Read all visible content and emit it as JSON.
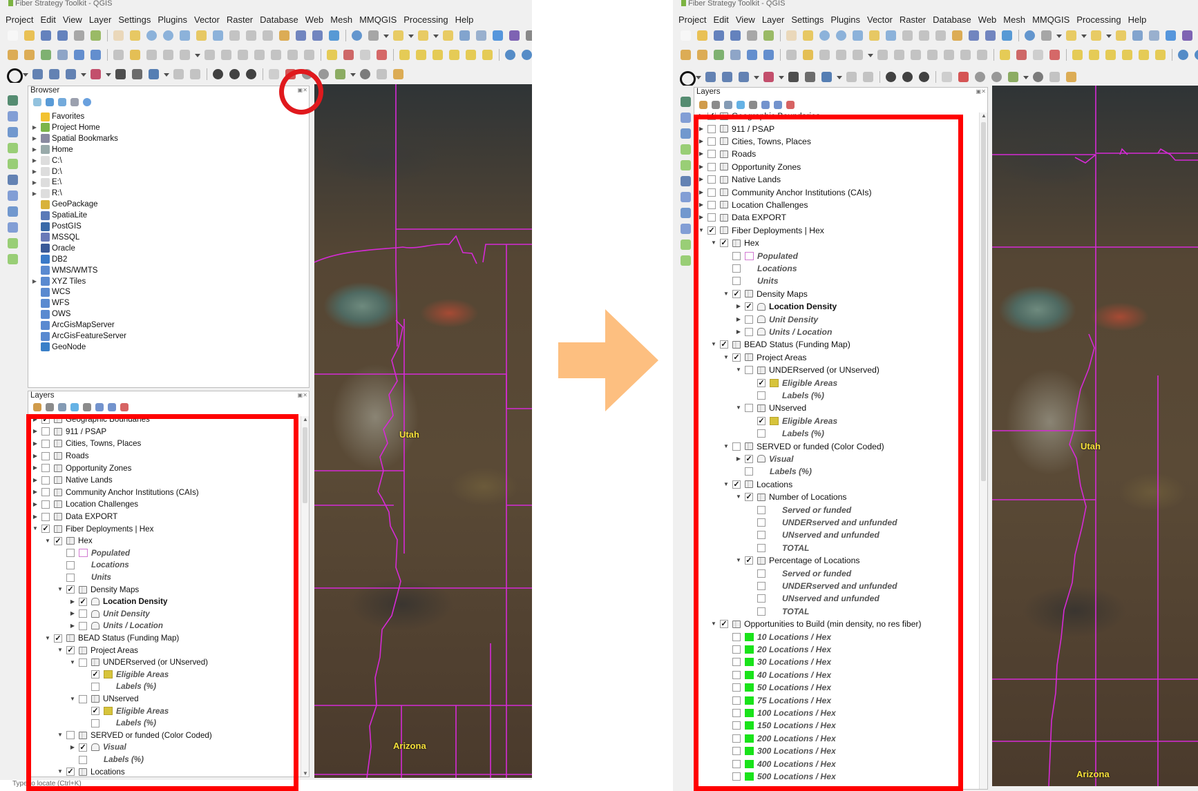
{
  "title_bar": {
    "text": "Fiber Strategy Toolkit - QGIS"
  },
  "menu": [
    "Project",
    "Edit",
    "View",
    "Layer",
    "Settings",
    "Plugins",
    "Vector",
    "Raster",
    "Database",
    "Web",
    "Mesh",
    "MMQGIS",
    "Processing",
    "Help"
  ],
  "browser": {
    "title": "Browser",
    "items": [
      {
        "label": "Favorites",
        "icon": "star-icon",
        "expandable": false
      },
      {
        "label": "Project Home",
        "icon": "project-home-icon",
        "expandable": true
      },
      {
        "label": "Spatial Bookmarks",
        "icon": "bookmarks-icon",
        "expandable": true
      },
      {
        "label": "Home",
        "icon": "home-folder-icon",
        "expandable": true
      },
      {
        "label": "C:\\",
        "icon": "drive-icon",
        "expandable": true
      },
      {
        "label": "D:\\",
        "icon": "drive-icon",
        "expandable": true
      },
      {
        "label": "E:\\",
        "icon": "drive-icon",
        "expandable": true
      },
      {
        "label": "R:\\",
        "icon": "drive-icon",
        "expandable": true
      },
      {
        "label": "GeoPackage",
        "icon": "geopackage-icon",
        "expandable": false
      },
      {
        "label": "SpatiaLite",
        "icon": "spatialite-icon",
        "expandable": false
      },
      {
        "label": "PostGIS",
        "icon": "postgis-icon",
        "expandable": false
      },
      {
        "label": "MSSQL",
        "icon": "mssql-icon",
        "expandable": false
      },
      {
        "label": "Oracle",
        "icon": "oracle-icon",
        "expandable": false
      },
      {
        "label": "DB2",
        "icon": "db2-icon",
        "expandable": false
      },
      {
        "label": "WMS/WMTS",
        "icon": "wms-icon",
        "expandable": false
      },
      {
        "label": "XYZ Tiles",
        "icon": "xyz-tiles-icon",
        "expandable": true
      },
      {
        "label": "WCS",
        "icon": "wcs-icon",
        "expandable": false
      },
      {
        "label": "WFS",
        "icon": "wfs-icon",
        "expandable": false
      },
      {
        "label": "OWS",
        "icon": "ows-icon",
        "expandable": false
      },
      {
        "label": "ArcGisMapServer",
        "icon": "arcgis-map-icon",
        "expandable": false
      },
      {
        "label": "ArcGisFeatureServer",
        "icon": "arcgis-feature-icon",
        "expandable": false
      },
      {
        "label": "GeoNode",
        "icon": "geonode-icon",
        "expandable": false
      }
    ]
  },
  "layers_panel": {
    "title": "Layers"
  },
  "layers": [
    {
      "d": 0,
      "exp": "r",
      "chk": "on",
      "icon": "group",
      "label": "Geographic Boundaries"
    },
    {
      "d": 0,
      "exp": "r",
      "chk": "off",
      "icon": "group",
      "label": "911 / PSAP"
    },
    {
      "d": 0,
      "exp": "r",
      "chk": "off",
      "icon": "group",
      "label": "Cities, Towns, Places"
    },
    {
      "d": 0,
      "exp": "r",
      "chk": "off",
      "icon": "group",
      "label": "Roads"
    },
    {
      "d": 0,
      "exp": "r",
      "chk": "off",
      "icon": "group",
      "label": "Opportunity Zones"
    },
    {
      "d": 0,
      "exp": "r",
      "chk": "off",
      "icon": "group",
      "label": "Native Lands"
    },
    {
      "d": 0,
      "exp": "r",
      "chk": "off",
      "icon": "group",
      "label": "Community Anchor Institutions (CAIs)"
    },
    {
      "d": 0,
      "exp": "r",
      "chk": "off",
      "icon": "group",
      "label": "Location Challenges"
    },
    {
      "d": 0,
      "exp": "r",
      "chk": "off",
      "icon": "group",
      "label": "Data EXPORT"
    },
    {
      "d": 0,
      "exp": "d",
      "chk": "on",
      "icon": "group",
      "label": "Fiber Deployments | Hex"
    },
    {
      "d": 1,
      "exp": "d",
      "chk": "on",
      "icon": "group",
      "label": "Hex"
    },
    {
      "d": 2,
      "exp": "",
      "chk": "off",
      "icon": "pop",
      "label": "Populated",
      "style": "it"
    },
    {
      "d": 2,
      "exp": "",
      "chk": "off",
      "icon": "none",
      "label": "Locations",
      "style": "it"
    },
    {
      "d": 2,
      "exp": "",
      "chk": "off",
      "icon": "none",
      "label": "Units",
      "style": "it"
    },
    {
      "d": 2,
      "exp": "d",
      "chk": "on",
      "icon": "group",
      "label": "Density Maps"
    },
    {
      "d": 3,
      "exp": "r",
      "chk": "on",
      "icon": "poly",
      "label": "Location Density",
      "style": "bold"
    },
    {
      "d": 3,
      "exp": "r",
      "chk": "off",
      "icon": "poly",
      "label": "Unit Density",
      "style": "it"
    },
    {
      "d": 3,
      "exp": "r",
      "chk": "off",
      "icon": "poly",
      "label": "Units / Location",
      "style": "it"
    },
    {
      "d": 1,
      "exp": "d",
      "chk": "on",
      "icon": "group",
      "label": "BEAD Status (Funding Map)"
    },
    {
      "d": 2,
      "exp": "d",
      "chk": "on",
      "icon": "group",
      "label": "Project Areas"
    },
    {
      "d": 3,
      "exp": "d",
      "chk": "off",
      "icon": "group",
      "label": "UNDERserved (or UNserved)"
    },
    {
      "d": 4,
      "exp": "",
      "chk": "on",
      "icon": "yellow",
      "label": "Eligible Areas",
      "style": "it"
    },
    {
      "d": 4,
      "exp": "",
      "chk": "off",
      "icon": "none",
      "label": "Labels (%)",
      "style": "it"
    },
    {
      "d": 3,
      "exp": "d",
      "chk": "off",
      "icon": "group",
      "label": "UNserved"
    },
    {
      "d": 4,
      "exp": "",
      "chk": "on",
      "icon": "yellow",
      "label": "Eligible Areas",
      "style": "it"
    },
    {
      "d": 4,
      "exp": "",
      "chk": "off",
      "icon": "none",
      "label": "Labels (%)",
      "style": "it"
    },
    {
      "d": 2,
      "exp": "d",
      "chk": "off",
      "icon": "group",
      "label": "SERVED or funded (Color Coded)"
    },
    {
      "d": 3,
      "exp": "r",
      "chk": "on",
      "icon": "poly",
      "label": "Visual",
      "style": "it"
    },
    {
      "d": 3,
      "exp": "",
      "chk": "off",
      "icon": "none",
      "label": "Labels (%)",
      "style": "it"
    },
    {
      "d": 2,
      "exp": "d",
      "chk": "on",
      "icon": "group",
      "label": "Locations"
    },
    {
      "d": 3,
      "exp": "d",
      "chk": "on",
      "icon": "group",
      "label": "Number of Locations"
    },
    {
      "d": 4,
      "exp": "",
      "chk": "off",
      "icon": "none",
      "label": "Served or funded",
      "style": "it"
    },
    {
      "d": 4,
      "exp": "",
      "chk": "off",
      "icon": "none",
      "label": "UNDERserved and unfunded",
      "style": "it"
    },
    {
      "d": 4,
      "exp": "",
      "chk": "off",
      "icon": "none",
      "label": "UNserved and unfunded",
      "style": "it"
    },
    {
      "d": 4,
      "exp": "",
      "chk": "off",
      "icon": "none",
      "label": "TOTAL",
      "style": "it"
    },
    {
      "d": 3,
      "exp": "d",
      "chk": "on",
      "icon": "group",
      "label": "Percentage of Locations"
    },
    {
      "d": 4,
      "exp": "",
      "chk": "off",
      "icon": "none",
      "label": "Served or funded",
      "style": "it"
    },
    {
      "d": 4,
      "exp": "",
      "chk": "off",
      "icon": "none",
      "label": "UNDERserved and unfunded",
      "style": "it"
    },
    {
      "d": 4,
      "exp": "",
      "chk": "off",
      "icon": "none",
      "label": "UNserved and unfunded",
      "style": "it"
    },
    {
      "d": 4,
      "exp": "",
      "chk": "off",
      "icon": "none",
      "label": "TOTAL",
      "style": "it"
    },
    {
      "d": 1,
      "exp": "d",
      "chk": "on",
      "icon": "group",
      "label": "Opportunities to Build (min density, no res fiber)"
    },
    {
      "d": 2,
      "exp": "",
      "chk": "off",
      "icon": "green",
      "label": "10 Locations / Hex",
      "style": "it"
    },
    {
      "d": 2,
      "exp": "",
      "chk": "off",
      "icon": "green",
      "label": "20 Locations / Hex",
      "style": "it"
    },
    {
      "d": 2,
      "exp": "",
      "chk": "off",
      "icon": "green",
      "label": "30 Locations / Hex",
      "style": "it"
    },
    {
      "d": 2,
      "exp": "",
      "chk": "off",
      "icon": "green",
      "label": "40 Locations / Hex",
      "style": "it"
    },
    {
      "d": 2,
      "exp": "",
      "chk": "off",
      "icon": "green",
      "label": "50 Locations / Hex",
      "style": "it"
    },
    {
      "d": 2,
      "exp": "",
      "chk": "off",
      "icon": "green",
      "label": "75 Locations / Hex",
      "style": "it"
    },
    {
      "d": 2,
      "exp": "",
      "chk": "off",
      "icon": "green",
      "label": "100 Locations / Hex",
      "style": "it"
    },
    {
      "d": 2,
      "exp": "",
      "chk": "off",
      "icon": "green",
      "label": "150 Locations / Hex",
      "style": "it"
    },
    {
      "d": 2,
      "exp": "",
      "chk": "off",
      "icon": "green",
      "label": "200 Locations / Hex",
      "style": "it"
    },
    {
      "d": 2,
      "exp": "",
      "chk": "off",
      "icon": "green",
      "label": "300 Locations / Hex",
      "style": "it"
    },
    {
      "d": 2,
      "exp": "",
      "chk": "off",
      "icon": "green",
      "label": "400 Locations / Hex",
      "style": "it"
    },
    {
      "d": 2,
      "exp": "",
      "chk": "off",
      "icon": "green",
      "label": "500 Locations / Hex",
      "style": "it"
    }
  ],
  "map_labels": {
    "utah": "Utah",
    "arizona": "Arizona"
  },
  "status_bar": {
    "locator_placeholder": "Type to locate (Ctrl+K)"
  },
  "colors": {
    "highlight": "#ff0000",
    "arrow": "#fdbf80",
    "boundary": "#d62ad6",
    "state_label": "#f6e13a",
    "opportunity_green": "#19e31a",
    "eligible_yellow": "#d7c43b"
  }
}
